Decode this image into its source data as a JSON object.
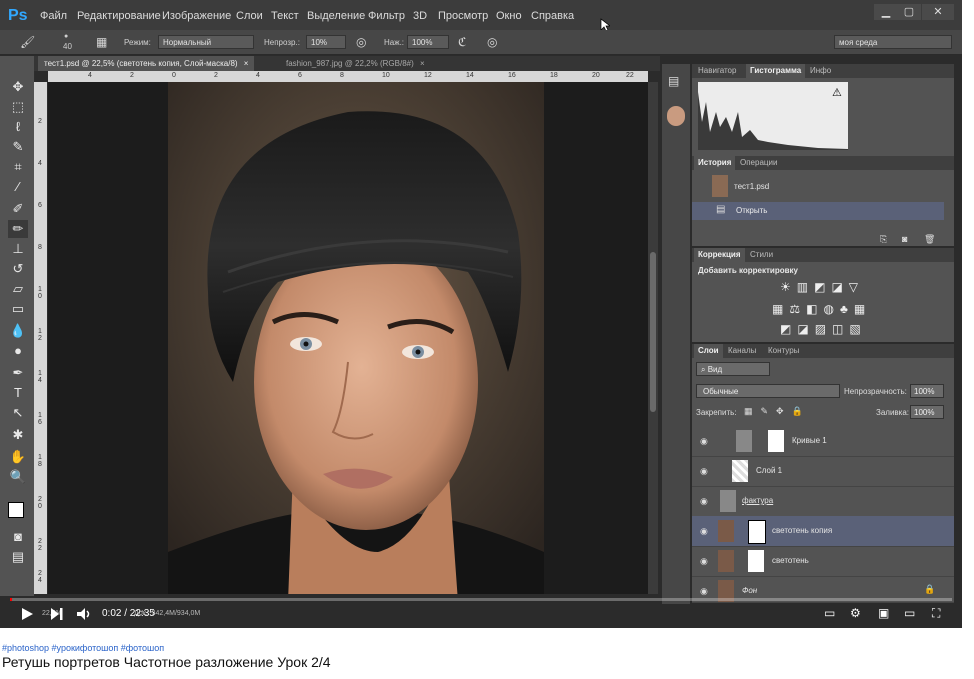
{
  "app": {
    "logo": "Ps"
  },
  "menu": [
    "Файл",
    "Редактирование",
    "Изображение",
    "Слои",
    "Текст",
    "Выделение",
    "Фильтр",
    "3D",
    "Просмотр",
    "Окно",
    "Справка"
  ],
  "window_controls": {
    "minimize": "▁",
    "maximize": "▢",
    "close": "✕"
  },
  "options": {
    "brush_size": "40",
    "mode_label": "Режим:",
    "mode_value": "Нормальный",
    "opacity_label": "Непрозр.:",
    "opacity_value": "10%",
    "flow_label": "Наж.:",
    "flow_value": "100%",
    "workspace": "моя среда"
  },
  "doc_tabs": [
    {
      "label": "тест1.psd @ 22,5% (светотень копия, Слой-маска/8)",
      "close": "×"
    },
    {
      "label": "fashion_987.jpg @ 22,2% (RGB/8#)",
      "close": "×"
    }
  ],
  "ruler_top": [
    "4",
    "2",
    "0",
    "2",
    "4",
    "6",
    "8",
    "10",
    "12",
    "14",
    "16",
    "18",
    "20",
    "22"
  ],
  "ruler_left": [
    "2",
    "4",
    "6",
    "8",
    "1 0",
    "1 2",
    "1 4",
    "1 6",
    "1 8",
    "2 0",
    "2 2",
    "2 4"
  ],
  "status": {
    "zoom": "22,5%",
    "doc": "Док.: 342,4M/934,0M"
  },
  "navigator": {
    "tabs": [
      "Навигатор",
      "Гистограмма",
      "Инфо"
    ],
    "warning": "⚠"
  },
  "history": {
    "tabs": [
      "История",
      "Операции"
    ],
    "snapshot": "тест1.psd",
    "items": [
      "Открыть"
    ]
  },
  "correction": {
    "tabs": [
      "Коррекция",
      "Стили"
    ],
    "title": "Добавить корректировку",
    "row1": [
      "☀",
      "▥",
      "◩",
      "◪",
      "▽"
    ],
    "row2": [
      "▦",
      "⚖",
      "◧",
      "◍",
      "♣",
      "▦"
    ],
    "row3": [
      "◩",
      "◪",
      "▨",
      "◫",
      "▧"
    ]
  },
  "layers": {
    "tabs": [
      "Слои",
      "Каналы",
      "Контуры"
    ],
    "filter": "Вид",
    "blend": "Обычные",
    "opacity_label": "Непрозрачность:",
    "opacity": "100%",
    "lock_label": "Закрепить:",
    "fill_label": "Заливка:",
    "fill": "100%",
    "items": [
      {
        "name": "Кривые 1"
      },
      {
        "name": "Слой 1"
      },
      {
        "name": "фактура"
      },
      {
        "name": "светотень копия"
      },
      {
        "name": "светотень"
      },
      {
        "name": "Фон"
      }
    ]
  },
  "player": {
    "time": "0:02 / 22:35",
    "progress": 0.0015
  },
  "caption": {
    "hashtags": "#photoshop #урокифотошоп #фотошоп",
    "title": "Ретушь портретов Частотное разложение Урок 2/4"
  },
  "colors": {
    "accent": "#31a8ff",
    "progress": "#ff0000",
    "selected_layer": "#5a6178"
  }
}
